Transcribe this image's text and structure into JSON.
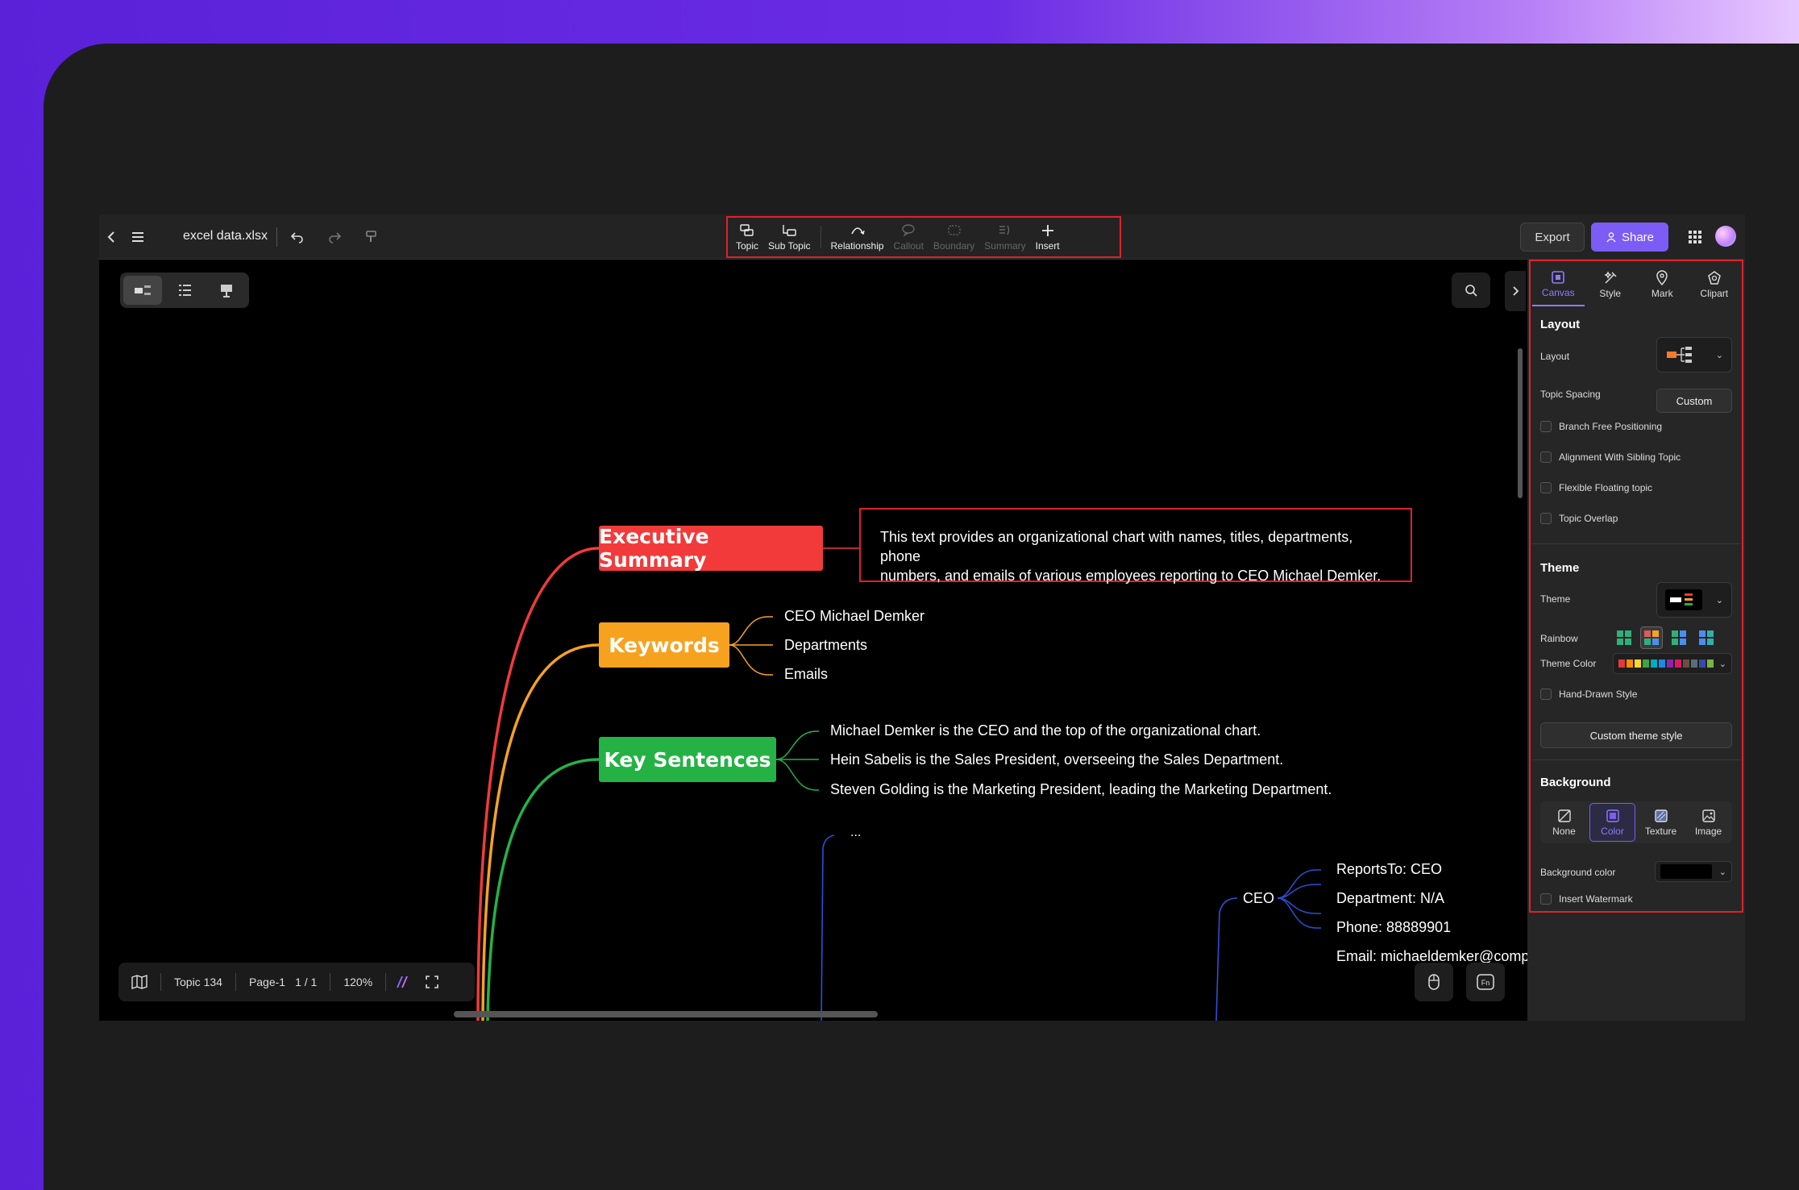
{
  "app": {
    "file_name": "excel data.xlsx",
    "export_label": "Export",
    "share_label": "Share"
  },
  "toolbar": {
    "tools": [
      {
        "label": "Topic",
        "icon": "topic-icon",
        "enabled": true
      },
      {
        "label": "Sub Topic",
        "icon": "subtopic-icon",
        "enabled": true
      },
      {
        "label": "Relationship",
        "icon": "relationship-icon",
        "enabled": true
      },
      {
        "label": "Callout",
        "icon": "callout-icon",
        "enabled": false
      },
      {
        "label": "Boundary",
        "icon": "boundary-icon",
        "enabled": false
      },
      {
        "label": "Summary",
        "icon": "summary-icon",
        "enabled": false
      },
      {
        "label": "Insert",
        "icon": "plus-icon",
        "enabled": true
      }
    ]
  },
  "mindmap": {
    "topics": {
      "executive_summary": {
        "label": "Executive Summary",
        "color": "#f23a3a"
      },
      "keywords": {
        "label": "Keywords",
        "color": "#f7a21f"
      },
      "key_sentences": {
        "label": "Key Sentences",
        "color": "#24b245"
      }
    },
    "summary_text_line1": "This text provides an organizational chart with names, titles, departments, phone",
    "summary_text_line2": "numbers, and emails of various employees reporting to CEO Michael Demker.",
    "keywords": [
      "CEO Michael Demker",
      "Departments",
      "Emails"
    ],
    "sentences": [
      "Michael Demker is the CEO and the top of the organizational chart.",
      "Hein Sabelis is the Sales President, overseeing the Sales Department.",
      "Steven Golding is the Marketing President, leading the Marketing Department."
    ],
    "ellipsis": "...",
    "ceo": {
      "label": "CEO",
      "details": [
        "ReportsTo: CEO",
        "Department: N/A",
        "Phone: 88889901",
        "Email: michaeldemker@compa"
      ]
    }
  },
  "status_bar": {
    "topic_count": "Topic 134",
    "page": "Page-1",
    "page_count": "1 / 1",
    "zoom": "120%"
  },
  "panel": {
    "tabs": [
      {
        "label": "Canvas",
        "icon": "canvas-icon",
        "active": true
      },
      {
        "label": "Style",
        "icon": "style-icon",
        "active": false
      },
      {
        "label": "Mark",
        "icon": "mark-icon",
        "active": false
      },
      {
        "label": "Clipart",
        "icon": "clipart-icon",
        "active": false
      }
    ],
    "layout": {
      "title": "Layout",
      "layout_label": "Layout",
      "spacing_label": "Topic Spacing",
      "spacing_value": "Custom",
      "options": [
        "Branch Free Positioning",
        "Alignment With Sibling Topic",
        "Flexible Floating topic",
        "Topic Overlap"
      ]
    },
    "theme": {
      "title": "Theme",
      "theme_label": "Theme",
      "rainbow_label": "Rainbow",
      "theme_color_label": "Theme Color",
      "hand_drawn_label": "Hand-Drawn Style",
      "custom_theme_label": "Custom theme style"
    },
    "background": {
      "title": "Background",
      "options": [
        {
          "label": "None",
          "active": false
        },
        {
          "label": "Color",
          "active": true
        },
        {
          "label": "Texture",
          "active": false
        },
        {
          "label": "Image",
          "active": false
        }
      ],
      "color_label": "Background color",
      "color_value": "#000000",
      "watermark_label": "Insert Watermark"
    }
  },
  "colors": {
    "accent": "#7b5cf5",
    "highlight": "#e0212a"
  }
}
